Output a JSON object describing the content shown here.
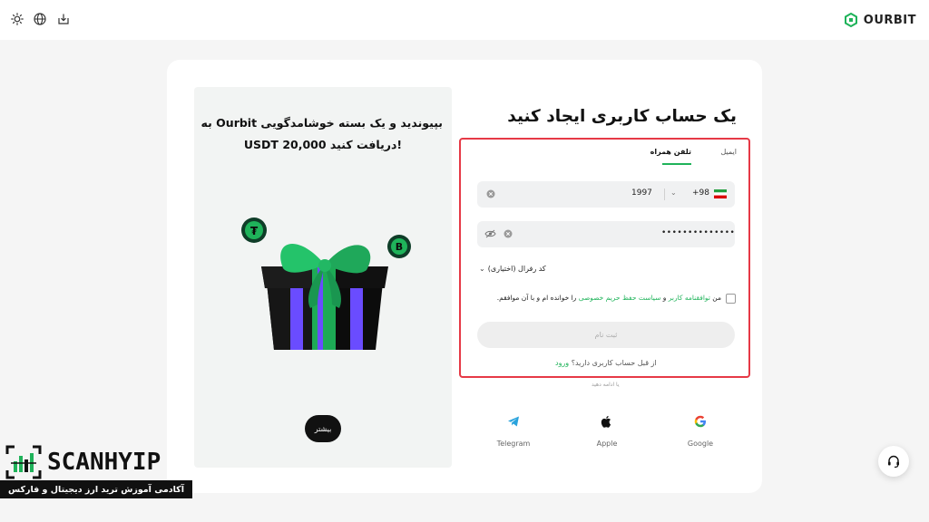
{
  "brand": {
    "name": "OURBIT",
    "accent": "#1fb35a"
  },
  "topbar": {
    "icons": [
      "theme-sun-icon",
      "globe-icon",
      "download-icon"
    ]
  },
  "promo": {
    "title_line1": "بپیوندید و یک بسته خوشامدگویی Ourbit به",
    "title_line2": "!دریافت کنید 20,000 USDT",
    "more_button": "بیشتر"
  },
  "form": {
    "title": "یک حساب کاربری ایجاد کنید",
    "tabs": {
      "phone": "تلفن همراه",
      "email": "ایمیل"
    },
    "phone": {
      "country_code": "+98",
      "value": "1997"
    },
    "password": {
      "value": "••••••••••••••"
    },
    "referral": "کد رفرال (اختیاری)",
    "agreement": {
      "prefix": "من",
      "terms": "توافقنامه کاربر",
      "and": "و",
      "privacy": "سیاست حفظ حریم خصوصی",
      "suffix": "را خوانده ام و با آن موافقم."
    },
    "submit": "ثبت نام",
    "login_prompt": "از قبل حساب کاربری دارید؟",
    "login_link": "ورود",
    "or_continue": "یا ادامه دهید"
  },
  "social": {
    "telegram": "Telegram",
    "apple": "Apple",
    "google": "Google"
  },
  "watermark": {
    "name": "SCANHYIP",
    "tagline": "آکادمی آموزش ترید ارز دیجیتال و فارکس"
  }
}
